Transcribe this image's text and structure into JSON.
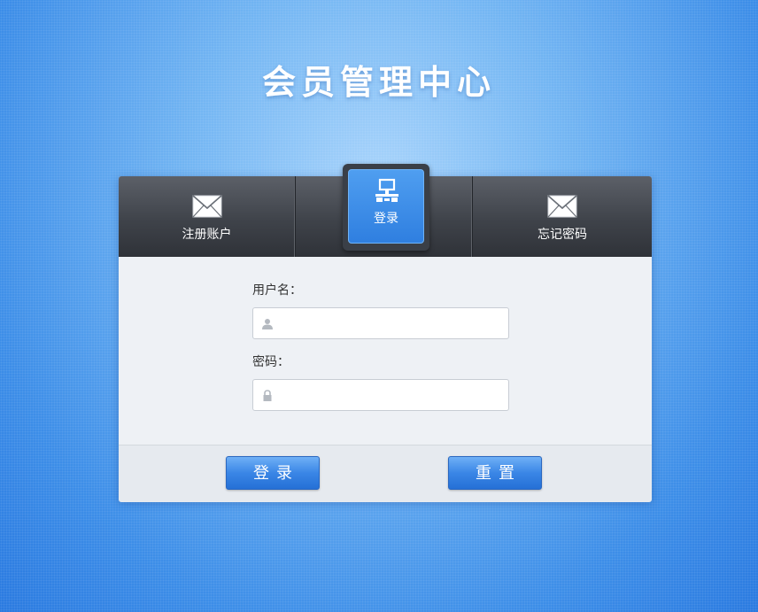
{
  "header": {
    "title": "会员管理中心"
  },
  "tabs": {
    "register": {
      "label": "注册账户",
      "icon": "envelope-icon"
    },
    "login": {
      "label": "登录",
      "icon": "network-icon"
    },
    "forgot": {
      "label": "忘记密码",
      "icon": "envelope-icon"
    }
  },
  "form": {
    "username": {
      "label": "用户名：",
      "placeholder": "",
      "value": "",
      "icon": "user-icon"
    },
    "password": {
      "label": "密码：",
      "placeholder": "",
      "value": "",
      "icon": "lock-icon"
    }
  },
  "buttons": {
    "login_label": "登录",
    "reset_label": "重置"
  },
  "colors": {
    "accent": "#2f7fe0",
    "tab_bar": "#3f434a",
    "panel": "#eef1f5"
  }
}
